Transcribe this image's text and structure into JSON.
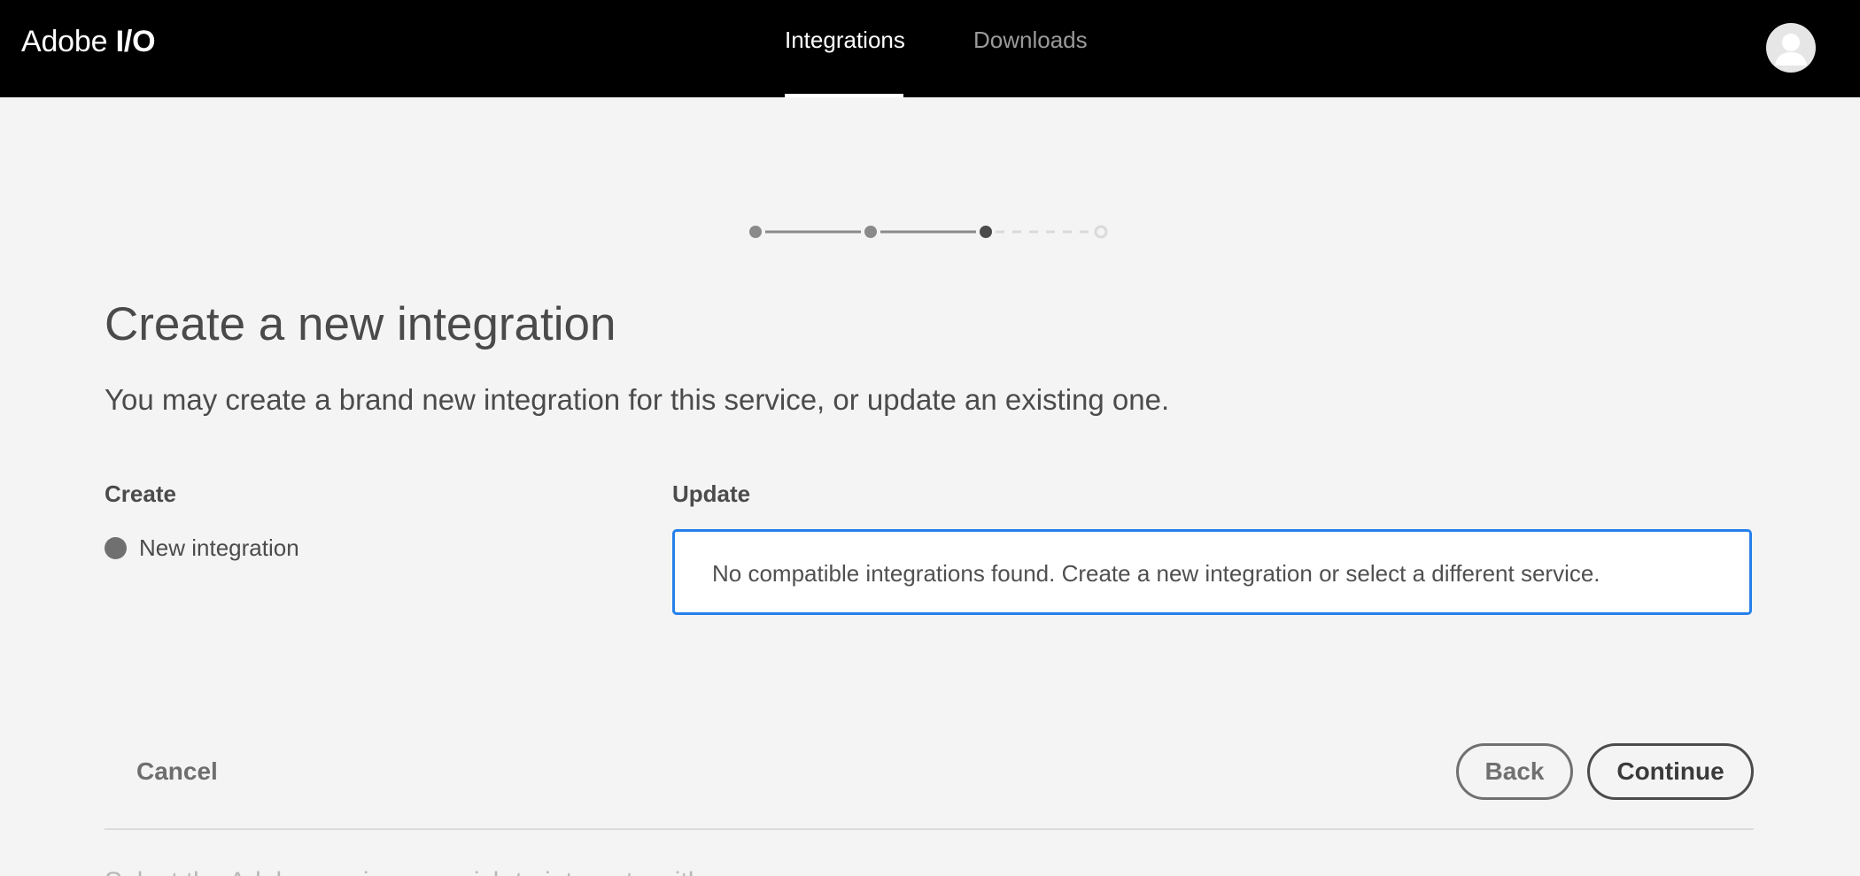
{
  "header": {
    "brand": {
      "name": "Adobe",
      "suffix": "I/O"
    },
    "tabs": [
      {
        "label": "Integrations",
        "active": true
      },
      {
        "label": "Downloads",
        "active": false
      }
    ],
    "avatar_icon": "user-avatar-icon"
  },
  "stepper": {
    "total_steps": 4,
    "current_step": 3,
    "colors": {
      "done": "#8a8a8a",
      "current": "#4b4b4b",
      "pending": "#dadada"
    }
  },
  "main": {
    "title": "Create a new integration",
    "subtitle": "You may create a brand new integration for this service, or update an existing one.",
    "create": {
      "heading": "Create",
      "option_label": "New integration"
    },
    "update": {
      "heading": "Update",
      "message": "No compatible integrations found. Create a new integration or select a different service."
    }
  },
  "actions": {
    "cancel_label": "Cancel",
    "back_label": "Back",
    "continue_label": "Continue"
  },
  "footer": {
    "partial_text": "Select the Adobe service you wish to integrate with"
  },
  "colors": {
    "header_bg": "#000000",
    "page_bg": "#f4f4f4",
    "accent_blue": "#2680eb"
  }
}
